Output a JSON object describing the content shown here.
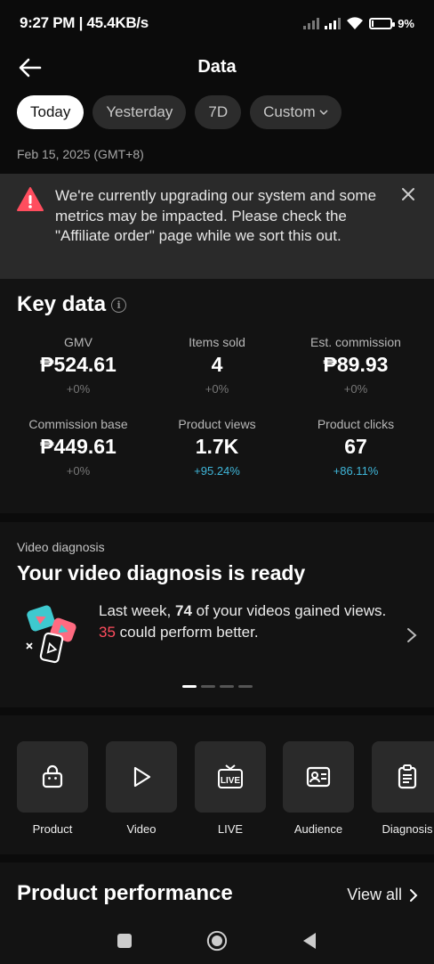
{
  "status_bar": {
    "time_speed": "9:27 PM | 45.4KB/s",
    "battery": "9%",
    "battery_level": 0.09
  },
  "header": {
    "title": "Data",
    "back_icon": "arrow-left-icon"
  },
  "tabs": [
    {
      "label": "Today",
      "active": true
    },
    {
      "label": "Yesterday",
      "active": false
    },
    {
      "label": "7D",
      "active": false
    },
    {
      "label": "Custom",
      "active": false
    }
  ],
  "date_line": "Feb 15, 2025 (GMT+8)",
  "alert": {
    "icon": "warning-icon",
    "text": "We're currently upgrading our system and some metrics may be impacted. Please check the \"Affiliate order\" page while we sort this out.",
    "close_icon": "close-icon",
    "icon_color": "#ff4d5e"
  },
  "key_data": {
    "title": "Key data",
    "metrics": [
      {
        "label": "GMV",
        "value": "₱524.61",
        "change": "+0%"
      },
      {
        "label": "Items sold",
        "value": "4",
        "change": "+0%"
      },
      {
        "label": "Est. commission",
        "value": "₱89.93",
        "change": "+0%"
      },
      {
        "label": "Commission base",
        "value": "₱449.61",
        "change": "+0%"
      },
      {
        "label": "Product views",
        "value": "1.7K",
        "change": "+95.24%"
      },
      {
        "label": "Product clicks",
        "value": "67",
        "change": "+86.11%"
      }
    ],
    "positive_color": "#3fb6d9"
  },
  "video_diagnosis": {
    "label": "Video diagnosis",
    "title": "Your video diagnosis is ready",
    "msg_a": "Last week, ",
    "count_a": "74",
    "msg_b": " of your videos gained views. ",
    "count_b": "35",
    "msg_c": " could perform better.",
    "highlight_color": "#ff4d5e"
  },
  "tools": [
    {
      "label": "Product",
      "icon": "shopping-bag-icon"
    },
    {
      "label": "Video",
      "icon": "play-icon"
    },
    {
      "label": "LIVE",
      "icon": "live-tv-icon"
    },
    {
      "label": "Audience",
      "icon": "id-card-icon"
    },
    {
      "label": "Diagnosis",
      "icon": "clipboard-icon"
    }
  ],
  "product_performance": {
    "title": "Product performance",
    "view_all": "View all"
  }
}
